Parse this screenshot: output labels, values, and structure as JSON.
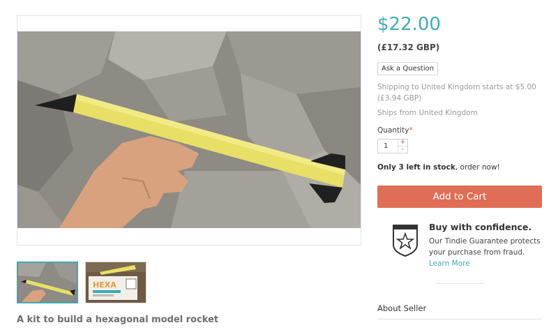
{
  "product": {
    "description": "A kit to build a hexagonal model rocket",
    "thumbnail_box_text": "HEXA"
  },
  "price": {
    "main": "$22.00",
    "converted": "(£17.32 GBP)"
  },
  "ask_question": "Ask a Question",
  "shipping": {
    "text": "Shipping to United Kingdom starts at $5.00 (£3.94 GBP)",
    "ships_from": "Ships from United Kingdom"
  },
  "quantity": {
    "label": "Quantity",
    "required_mark": "*",
    "value": "1",
    "plus": "+",
    "minus": "–"
  },
  "stock": {
    "bold": "Only 3 left in stock",
    "rest": ", order now!"
  },
  "cart_button": "Add to Cart",
  "confidence": {
    "title": "Buy with confidence.",
    "text": "Our Tindie Guarantee protects your purchase from fraud.",
    "link": "Learn More"
  },
  "about_seller": "About Seller",
  "colors": {
    "accent": "#45aab5",
    "cart": "#e06d55"
  }
}
